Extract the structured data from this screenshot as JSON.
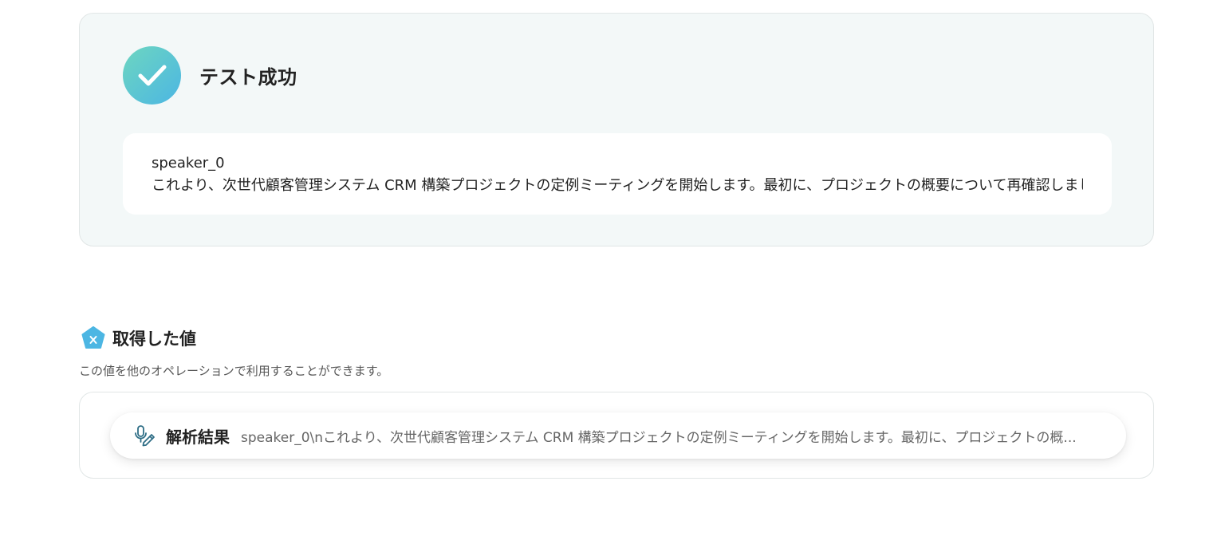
{
  "success": {
    "title": "テスト成功",
    "output_speaker": "speaker_0",
    "output_text": "これより、次世代顧客管理システム CRM 構築プロジェクトの定例ミーティングを開始します。最初に、プロジェクトの概要について再確認しましょう"
  },
  "acquired": {
    "title": "取得した値",
    "description": "この値を他のオペレーションで利用することができます。",
    "items": [
      {
        "label": "解析結果",
        "value": "speaker_0\\nこれより、次世代顧客管理システム CRM 構築プロジェクトの定例ミーティングを開始します。最初に、プロジェクトの概...",
        "icon": "microphone-icon"
      }
    ]
  },
  "colors": {
    "check_gradient_start": "#6dd6c0",
    "check_gradient_end": "#4cb6e3",
    "panel_bg": "#f3f8f8",
    "pentagon_icon": "#4cb6e3",
    "mic_icon": "#2f6e86"
  }
}
